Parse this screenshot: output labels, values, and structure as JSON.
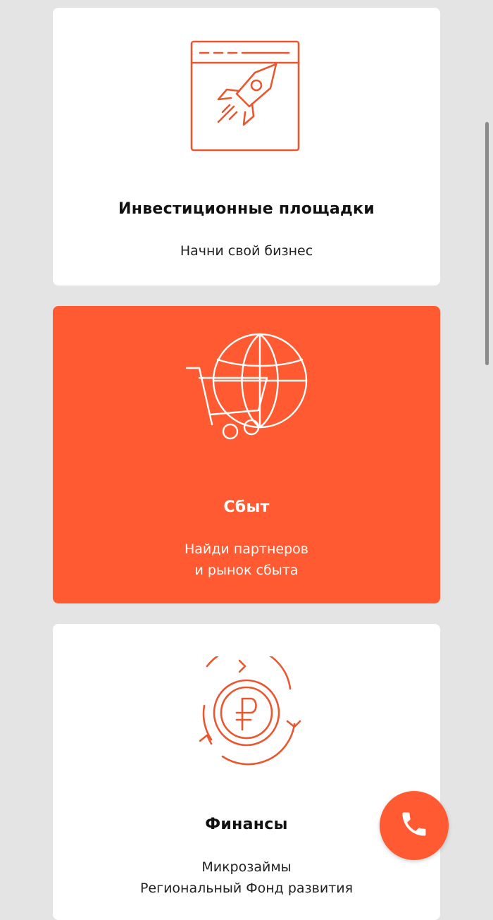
{
  "colors": {
    "background": "#e4e4e4",
    "accent": "#ff5a32",
    "icon_stroke": "#e9572f",
    "card_white": "#ffffff",
    "scrollbar": "#8a8a8a"
  },
  "cards": [
    {
      "title": "Инвестиционные площадки",
      "description": [
        "Начни свой бизнес"
      ],
      "icon": "rocket-window-icon",
      "variant": "white"
    },
    {
      "title": "Сбыт",
      "description": [
        "Найди партнеров",
        "и рынок сбыта"
      ],
      "icon": "cart-globe-icon",
      "variant": "orange"
    },
    {
      "title": "Финансы",
      "description": [
        "Микрозаймы",
        "Региональный Фонд развития"
      ],
      "icon": "ruble-cycle-icon",
      "variant": "white"
    }
  ],
  "call_button": {
    "icon": "phone-icon"
  }
}
